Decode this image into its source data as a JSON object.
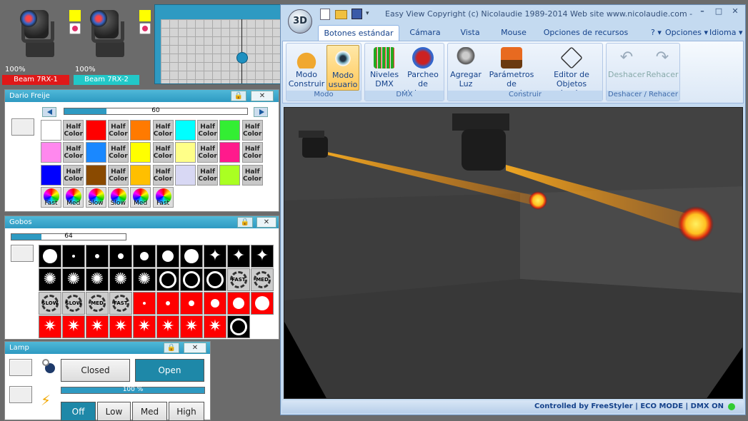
{
  "fixtures": [
    {
      "name": "Beam 7RX-1",
      "dimmer": "100%",
      "name_color": "#ff2a2a"
    },
    {
      "name": "Beam 7RX-2",
      "dimmer": "100%",
      "name_color": "#2ad4d4"
    }
  ],
  "color_panel": {
    "title": "Dario Freije",
    "value": "60",
    "value_fraction": 0.21,
    "swatches": [
      [
        "#ffffff",
        "#ff0000",
        "#ff7a00",
        "#00ffff",
        "#33ee33"
      ],
      [
        "#ff88ee",
        "#1a88ff",
        "#ffff00",
        "#ffff88",
        "#ff1a8c"
      ],
      [
        "#0000ff",
        "#8a4a00",
        "#ffbf00",
        "#d8d8f4",
        "#aaff22"
      ]
    ],
    "half_color_label_1": "Half",
    "half_color_label_2": "Color",
    "wheels": [
      "Fast",
      "Med",
      "Slow",
      "Slow",
      "Med",
      "Fast"
    ]
  },
  "gobos_panel": {
    "title": "Gobos",
    "value": "64",
    "value_fraction": 0.16,
    "speed_labels": [
      "FAST",
      "MED",
      "SLOW",
      "SLOW",
      "MED",
      "FAST"
    ]
  },
  "lamp_panel": {
    "title": "Lamp",
    "closed_label": "Closed",
    "open_label": "Open",
    "intensity": "100 %",
    "intensity_fraction": 1.0,
    "modes": [
      "Off",
      "Low",
      "Med",
      "High"
    ],
    "active_mode": "Off"
  },
  "easy_view": {
    "title": "Easy View   Copyright (c) Nicolaudie 1989-2014   Web site www.nicolaudie.com - s...",
    "logo": "3D",
    "tabs": [
      "Botones estándar",
      "Cámara",
      "Vista",
      "Mouse",
      "Opciones de recursos"
    ],
    "help": "?",
    "options": "Opciones",
    "language": "Idioma",
    "groups": {
      "modo": {
        "label": "Modo",
        "buttons": [
          "Modo Construir",
          "Modo usuario"
        ]
      },
      "dmx": {
        "label": "DMX",
        "buttons": [
          "Niveles DMX",
          "Parcheo de Universos"
        ]
      },
      "construir": {
        "label": "Construir",
        "buttons": [
          "Agregar Luz",
          "Parámetros de escenario...",
          "Editor de Objetos simples"
        ]
      },
      "undo": {
        "label": "Deshacer / Rehacer",
        "buttons": [
          "Deshacer",
          "Rehacer"
        ]
      }
    },
    "status": {
      "text": "Controlled by FreeStyler | ECO MODE | DMX ON"
    }
  }
}
